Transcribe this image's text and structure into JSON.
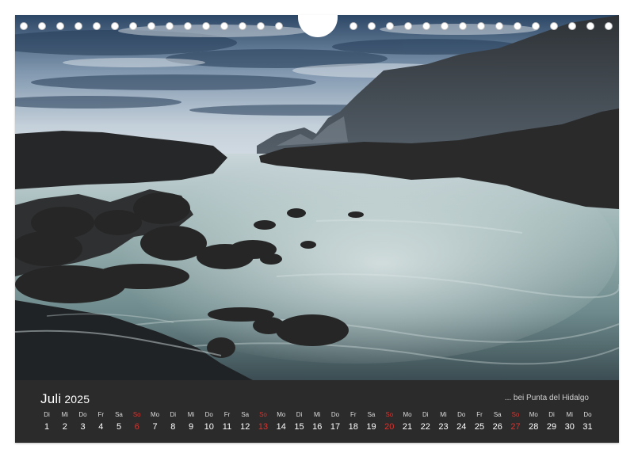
{
  "calendar": {
    "month": "Juli",
    "year": "2025",
    "caption": "... bei Punta del Hidalgo",
    "days": [
      {
        "wd": "Di",
        "d": "1"
      },
      {
        "wd": "Mi",
        "d": "2"
      },
      {
        "wd": "Do",
        "d": "3"
      },
      {
        "wd": "Fr",
        "d": "4"
      },
      {
        "wd": "Sa",
        "d": "5"
      },
      {
        "wd": "So",
        "d": "6",
        "sunday": true
      },
      {
        "wd": "Mo",
        "d": "7"
      },
      {
        "wd": "Di",
        "d": "8"
      },
      {
        "wd": "Mi",
        "d": "9"
      },
      {
        "wd": "Do",
        "d": "10"
      },
      {
        "wd": "Fr",
        "d": "11"
      },
      {
        "wd": "Sa",
        "d": "12"
      },
      {
        "wd": "So",
        "d": "13",
        "sunday": true
      },
      {
        "wd": "Mo",
        "d": "14"
      },
      {
        "wd": "Di",
        "d": "15"
      },
      {
        "wd": "Mi",
        "d": "16"
      },
      {
        "wd": "Do",
        "d": "17"
      },
      {
        "wd": "Fr",
        "d": "18"
      },
      {
        "wd": "Sa",
        "d": "19"
      },
      {
        "wd": "So",
        "d": "20",
        "sunday": true
      },
      {
        "wd": "Mo",
        "d": "21"
      },
      {
        "wd": "Di",
        "d": "22"
      },
      {
        "wd": "Mi",
        "d": "23"
      },
      {
        "wd": "Do",
        "d": "24"
      },
      {
        "wd": "Fr",
        "d": "25"
      },
      {
        "wd": "Sa",
        "d": "26"
      },
      {
        "wd": "So",
        "d": "27",
        "sunday": true
      },
      {
        "wd": "Mo",
        "d": "28"
      },
      {
        "wd": "Di",
        "d": "29"
      },
      {
        "wd": "Mi",
        "d": "30"
      },
      {
        "wd": "Do",
        "d": "31"
      }
    ]
  },
  "colors": {
    "panel_background": "#2b2b2b",
    "sunday": "#e0302b",
    "text": "#ffffff"
  }
}
